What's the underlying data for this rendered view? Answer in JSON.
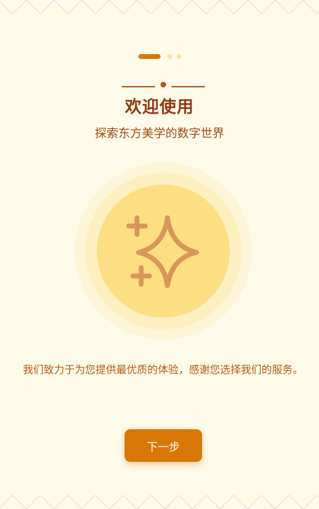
{
  "colors": {
    "background": "#fefaea",
    "accent": "#d97706",
    "title": "#8b3a12",
    "text": "#9a4d17",
    "circle_outer": "#fdf1c4",
    "circle_inner": "#fce083",
    "sparkle": "#d9965a"
  },
  "pager": {
    "total": 3,
    "active_index": 0
  },
  "hero": {
    "title": "欢迎使用",
    "subtitle": "探索东方美学的数字世界",
    "icon": "sparkles-icon"
  },
  "description": "我们致力于为您提供最优质的体验，感谢您选择我们的服务。",
  "actions": {
    "next_label": "下一步"
  }
}
